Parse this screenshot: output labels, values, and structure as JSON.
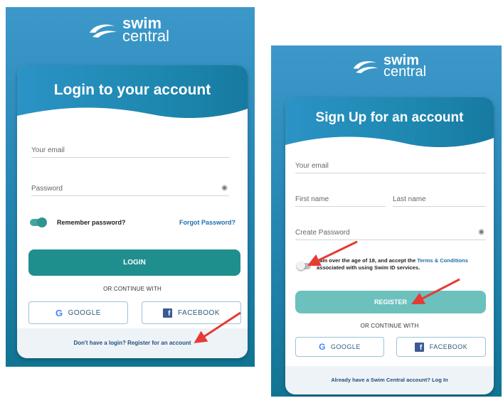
{
  "brand": {
    "line1": "swim",
    "line2": "central"
  },
  "login": {
    "title": "Login to your account",
    "email_placeholder": "Your email",
    "password_placeholder": "Password",
    "remember_label": "Remember password?",
    "forgot_label": "Forgot Password?",
    "login_button": "LOGIN",
    "or_continue": "OR CONTINUE WITH",
    "google_label": "GOOGLE",
    "facebook_label": "FACEBOOK",
    "footer_text": "Don't have a login? Register for an account"
  },
  "signup": {
    "title": "Sign Up for an account",
    "email_placeholder": "Your email",
    "first_name_placeholder": "First name",
    "last_name_placeholder": "Last name",
    "password_placeholder": "Create Password",
    "terms_prefix": "I am over the age of 18, and accept the ",
    "terms_link": "Terms & Conditions",
    "terms_suffix": " associated with using Swim ID services.",
    "register_button": "REGISTER",
    "or_continue": "OR CONTINUE WITH",
    "google_label": "GOOGLE",
    "facebook_label": "FACEBOOK",
    "footer_text": "Already have a Swim Central account? Log In"
  },
  "icons": {
    "google": "G",
    "facebook": "f",
    "eye": "◉"
  },
  "colors": {
    "panel_blue": "#2a8ab8",
    "login_button": "#1f8f8d",
    "register_button": "#6cc1bd",
    "annotation_arrow": "#e53b35"
  }
}
